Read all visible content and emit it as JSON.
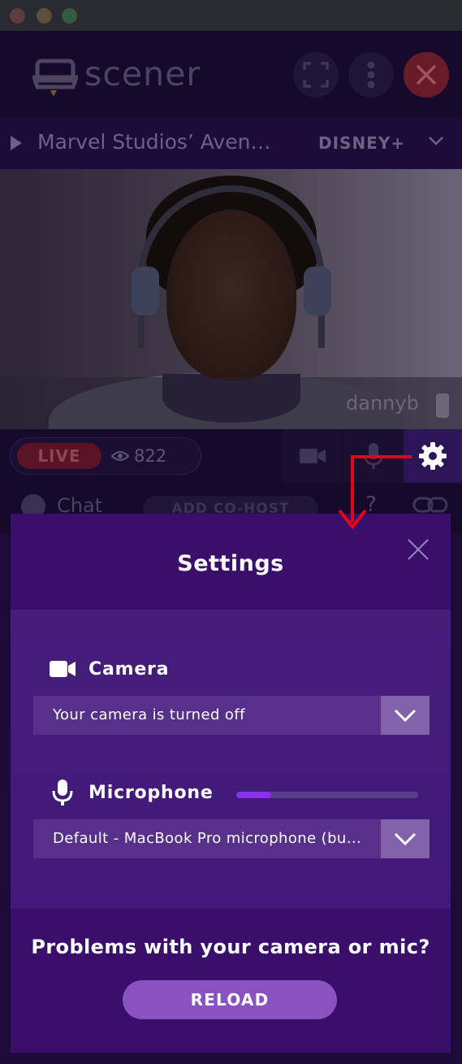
{
  "app": {
    "brand": "scener",
    "colors": {
      "background": "#1c0b38",
      "modal_header": "#3a0f6b",
      "modal_body": "#451e7a",
      "accent": "#8a52c0",
      "mic_level": "#8b2ff0",
      "live": "#5a1325",
      "annotation_arrow": "#e30613"
    }
  },
  "header": {
    "fullscreen_icon": "fullscreen-icon",
    "more_icon": "more-vertical-icon",
    "close_icon": "close-icon"
  },
  "now_playing": {
    "title": "Marvel Studios’ Aven…",
    "service": "DISNEY+"
  },
  "video": {
    "participant": "dannyb"
  },
  "controls": {
    "live_label": "LIVE",
    "viewer_count": "822"
  },
  "chat": {
    "label": "Chat",
    "add_cohost": "ADD CO-HOST",
    "help": "?"
  },
  "settings": {
    "title": "Settings",
    "camera": {
      "label": "Camera",
      "selected": "Your camera is turned off"
    },
    "microphone": {
      "label": "Microphone",
      "selected": "Default - MacBook Pro microphone (bu…",
      "level": 0.19
    },
    "footer": {
      "problems_text": "Problems with your camera or mic?",
      "reload_label": "RELOAD"
    }
  }
}
